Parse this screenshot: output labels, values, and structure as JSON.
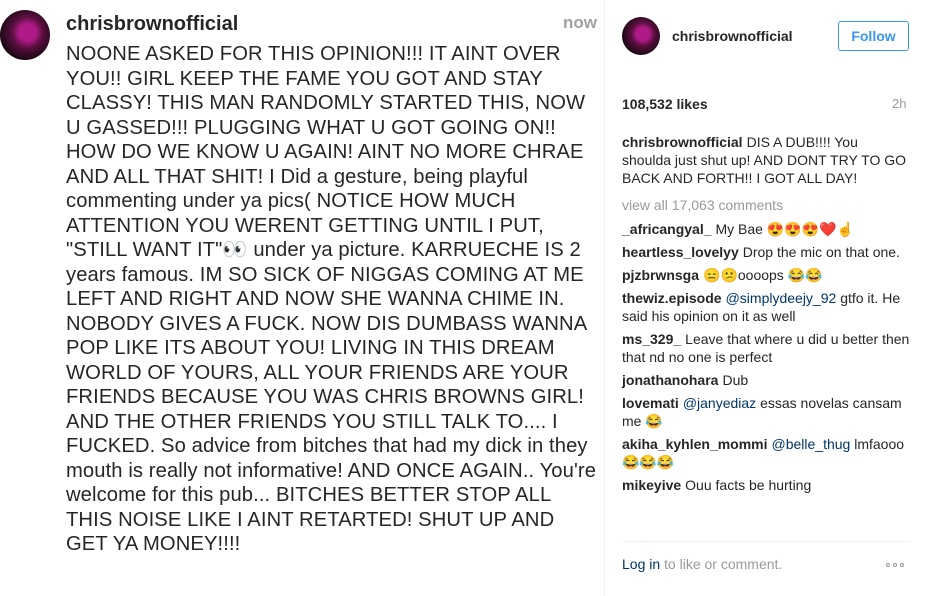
{
  "post": {
    "username": "chrisbrownofficial",
    "time": "now",
    "text": "NOONE ASKED FOR THIS OPINION!!! IT AINT OVER YOU!! GIRL KEEP THE FAME YOU GOT AND STAY CLASSY! THIS MAN RANDOMLY STARTED THIS, NOW U GASSED!!! PLUGGING WHAT U GOT GOING ON!! HOW DO WE KNOW U AGAIN! AINT NO MORE CHRAE AND ALL THAT SHIT! I Did a gesture, being playful commenting under ya pics( NOTICE HOW MUCH ATTENTION YOU WERENT GETTING UNTIL I PUT, \"STILL WANT IT\"👀 under ya picture. KARRUECHE IS 2 years famous. IM SO SICK OF NIGGAS COMING AT ME LEFT AND RIGHT AND NOW SHE WANNA CHIME IN. NOBODY GIVES A FUCK. NOW DIS DUMBASS WANNA POP LIKE ITS ABOUT YOU! LIVING IN THIS DREAM WORLD OF YOURS, ALL YOUR FRIENDS ARE YOUR FRIENDS BECAUSE YOU WAS CHRIS BROWNS GIRL! AND THE OTHER FRIENDS YOU STILL TALK TO.... I FUCKED. So advice from bitches that had my dick in they mouth is really not informative! AND ONCE AGAIN.. You're welcome for this pub... BITCHES BETTER STOP ALL THIS NOISE LIKE I AINT RETARTED! SHUT UP AND GET YA MONEY!!!!"
  },
  "sidebar": {
    "username": "chrisbrownofficial",
    "follow_label": "Follow",
    "likes": "108,532 likes",
    "time": "2h",
    "caption": {
      "user": "chrisbrownofficial",
      "text": "DIS A DUB!!!! You shoulda just shut up! AND DONT TRY TO GO BACK AND FORTH!! I GOT ALL DAY!"
    },
    "view_all": "view all 17,063 comments",
    "comments": [
      {
        "user": "_africangyal_",
        "mention": "",
        "text": "My Bae 😍😍😍❤️☝"
      },
      {
        "user": "heartless_lovelyy",
        "mention": "",
        "text": "Drop the mic on that one."
      },
      {
        "user": "pjzbrwnsga",
        "mention": "",
        "text": "😑😕oooops 😂😂"
      },
      {
        "user": "thewiz.episode",
        "mention": "@simplydeejy_92",
        "text": "gtfo it. He said his opinion on it as well"
      },
      {
        "user": "ms_329_",
        "mention": "",
        "text": "Leave that where u did u better then that nd no one is perfect"
      },
      {
        "user": "jonathanohara",
        "mention": "",
        "text": "Dub"
      },
      {
        "user": "lovemati",
        "mention": "@janyediaz",
        "text": "essas novelas cansam me 😂"
      },
      {
        "user": "akiha_kyhlen_mommi",
        "mention": "@belle_thug",
        "text": "lmfaooo 😂😂😂"
      },
      {
        "user": "mikeyive",
        "mention": "",
        "text": "Ouu facts be hurting"
      }
    ],
    "login_link": "Log in",
    "login_rest": "to like or comment."
  },
  "icons": {
    "more": "more-options-icon"
  },
  "colors": {
    "link": "#003569",
    "follow": "#3897f0",
    "muted": "#999999",
    "text": "#262626"
  }
}
